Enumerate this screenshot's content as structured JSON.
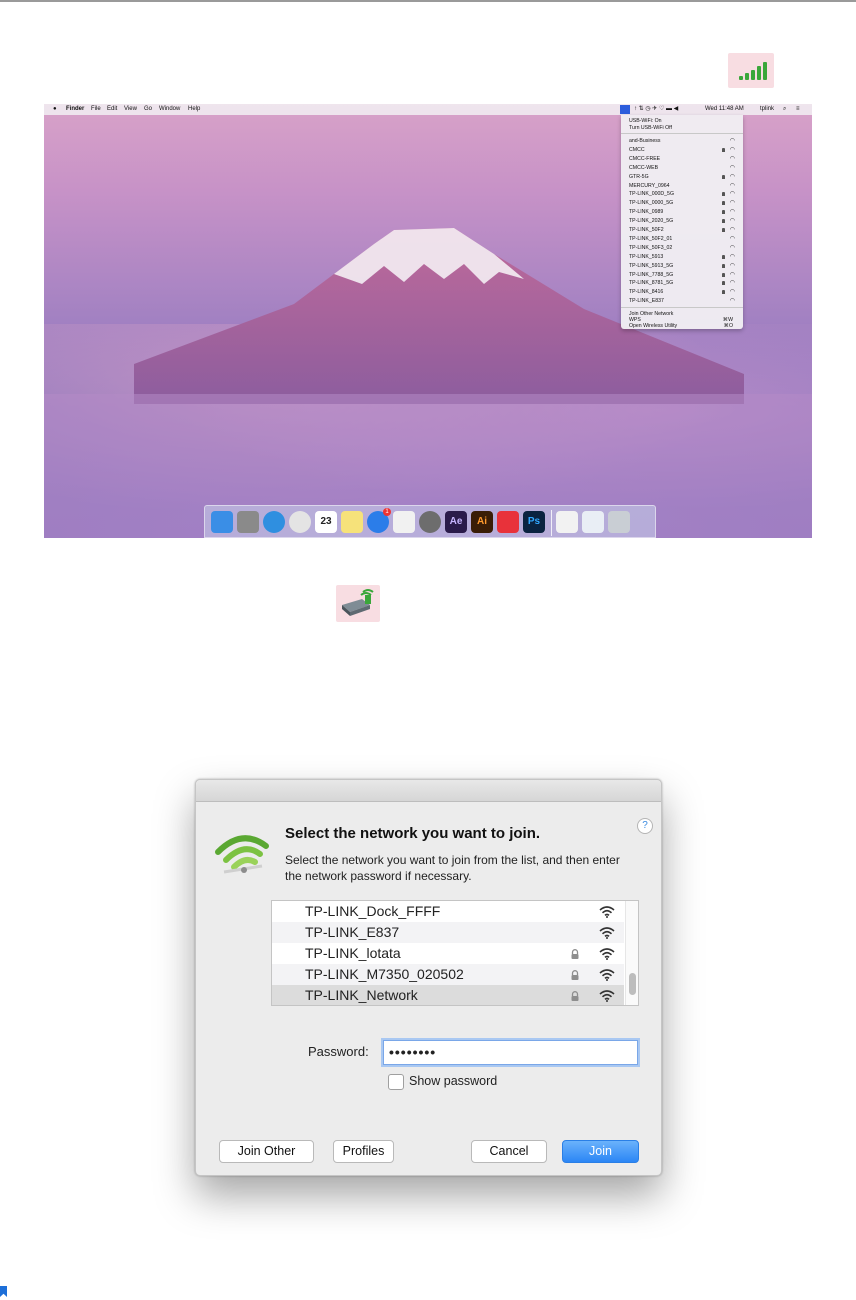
{
  "menubar": {
    "apple": "",
    "items": [
      "Finder",
      "File",
      "Edit",
      "View",
      "Go",
      "Window",
      "Help"
    ],
    "clock": "Wed 11:48 AM",
    "user": "tplink"
  },
  "wifi_menu": {
    "header": [
      "USB-WiFi: On",
      "Turn USB-WiFi Off"
    ],
    "networks": [
      {
        "name": "and-Business",
        "locked": false
      },
      {
        "name": "CMCC",
        "locked": true
      },
      {
        "name": "CMCC-FREE",
        "locked": false
      },
      {
        "name": "CMCC-WEB",
        "locked": false
      },
      {
        "name": "GTR-5G",
        "locked": true
      },
      {
        "name": "MERCURY_0964",
        "locked": false
      },
      {
        "name": "TP-LINK_000D_5G",
        "locked": true
      },
      {
        "name": "TP-LINK_0000_5G",
        "locked": true
      },
      {
        "name": "TP-LINK_0989",
        "locked": true
      },
      {
        "name": "TP-LINK_2020_5G",
        "locked": true
      },
      {
        "name": "TP-LINK_50F2",
        "locked": true
      },
      {
        "name": "TP-LINK_50F2_01",
        "locked": false
      },
      {
        "name": "TP-LINK_50F3_02",
        "locked": false
      },
      {
        "name": "TP-LINK_5913",
        "locked": true
      },
      {
        "name": "TP-LINK_5913_5G",
        "locked": true
      },
      {
        "name": "TP-LINK_7788_5G",
        "locked": true
      },
      {
        "name": "TP-LINK_8781_5G",
        "locked": true
      },
      {
        "name": "TP-LINK_8416",
        "locked": true
      },
      {
        "name": "TP-LINK_E837",
        "locked": false
      }
    ],
    "footer": [
      {
        "label": "Join Other Network",
        "shortcut": ""
      },
      {
        "label": "WPS",
        "shortcut": "⌘W"
      },
      {
        "label": "Open Wireless Utility",
        "shortcut": "⌘O"
      }
    ]
  },
  "dock": {
    "items": [
      "finder-icon",
      "launchpad-icon",
      "safari-icon",
      "chrome-icon",
      "calendar-icon",
      "notes-icon",
      "appstore-icon",
      "textedit-icon",
      "system-preferences-icon",
      "after-effects-icon",
      "illustrator-icon",
      "ps-red-icon",
      "photoshop-icon",
      "usb-drive-icon",
      "browser-window-icon",
      "trash-icon"
    ],
    "calendar_day": "23",
    "ae_label": "Ae",
    "ai_label": "Ai",
    "ps_label": "Ps",
    "badge": "1"
  },
  "dialog": {
    "title": "Select the network you want to join.",
    "subtitle": "Select the network you want to join from the list, and then enter the network password if necessary.",
    "help": "?",
    "networks": [
      {
        "name": "TP-LINK_Dock_FFFF",
        "locked": false
      },
      {
        "name": "TP-LINK_E837",
        "locked": false
      },
      {
        "name": "TP-LINK_lotata",
        "locked": true
      },
      {
        "name": "TP-LINK_M7350_020502",
        "locked": true
      },
      {
        "name": "TP-LINK_Network",
        "locked": true,
        "selected": true
      }
    ],
    "password_label": "Password:",
    "password_value": "••••••••",
    "show_password_label": "Show password",
    "show_password_checked": false,
    "buttons": {
      "join_other": "Join Other",
      "profiles": "Profiles",
      "cancel": "Cancel",
      "join": "Join"
    }
  }
}
